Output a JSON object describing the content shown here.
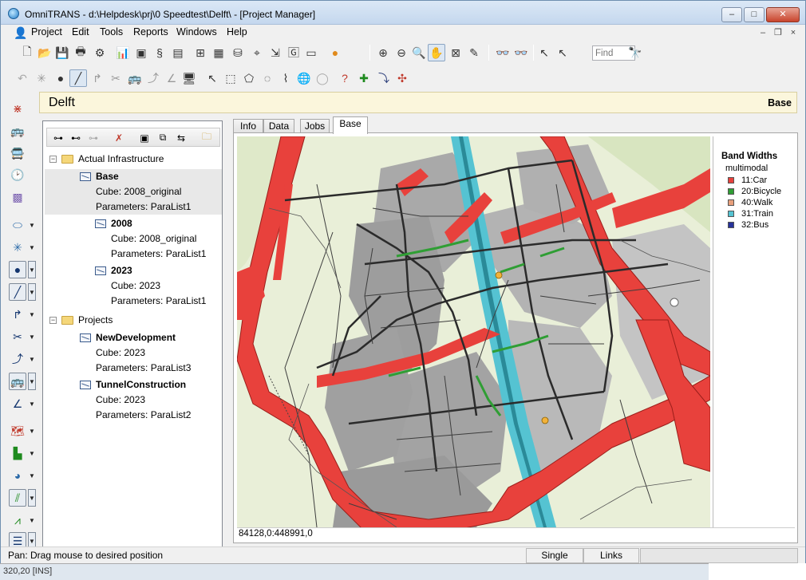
{
  "window": {
    "title": "OmniTRANS - d:\\Helpdesk\\prj\\0 Speedtest\\Delft\\ - [Project Manager]",
    "controls": {
      "minimize": "–",
      "maximize": "□",
      "close": "✕"
    }
  },
  "menubar": {
    "items": [
      "Project",
      "Edit",
      "Tools",
      "Reports",
      "Windows",
      "Help"
    ],
    "mdi_controls": {
      "minimize": "–",
      "restore": "❐",
      "close": "×"
    }
  },
  "toolbar": {
    "find_placeholder": "Find",
    "icons_row1": [
      "new-document",
      "open-folder",
      "save",
      "print",
      "settings-gear",
      "chart",
      "cube",
      "script",
      "report",
      "table",
      "matrix",
      "database",
      "network",
      "import",
      "globe",
      "toggle",
      "coin"
    ],
    "icons_row1_view": [
      "zoom-in",
      "zoom-out",
      "zoom-extent",
      "pan-hand",
      "zoom-window",
      "edit-pencil",
      "select-plus",
      "select-minus",
      "pointer-add",
      "pointer-remove"
    ],
    "icons_row2": [
      "undo",
      "star-node",
      "node",
      "link",
      "turn",
      "cut",
      "vehicle",
      "path",
      "angle",
      "screen",
      "pointer",
      "select-box",
      "select-poly",
      "select-circle",
      "select-free",
      "globe",
      "circle",
      "question",
      "add-cross",
      "connect",
      "split"
    ]
  },
  "header": {
    "title": "Delft",
    "scenario": "Base"
  },
  "tree": {
    "nodes": [
      {
        "type": "folder",
        "label": "Actual Infrastructure",
        "expander": "−"
      },
      {
        "type": "scenario",
        "label": "Base",
        "cube": "Cube: 2008_original",
        "params": "Parameters: ParaList1"
      },
      {
        "type": "scenario",
        "label": "2008",
        "cube": "Cube: 2008_original",
        "params": "Parameters: ParaList1"
      },
      {
        "type": "scenario",
        "label": "2023",
        "cube": "Cube: 2023",
        "params": "Parameters: ParaList1"
      },
      {
        "type": "folder",
        "label": "Projects",
        "expander": "−"
      },
      {
        "type": "scenario",
        "label": "NewDevelopment",
        "cube": "Cube: 2023",
        "params": "Parameters: ParaList3"
      },
      {
        "type": "scenario",
        "label": "TunnelConstruction",
        "cube": "Cube: 2023",
        "params": "Parameters: ParaList2"
      }
    ]
  },
  "tabs": [
    "Info",
    "Data",
    "Jobs",
    "Base"
  ],
  "active_tab": "Base",
  "legend": {
    "title": "Band Widths",
    "subtitle": "multimodal",
    "items": [
      {
        "label": "11:Car",
        "color": "#e8413c"
      },
      {
        "label": "20:Bicycle",
        "color": "#2f9e34"
      },
      {
        "label": "40:Walk",
        "color": "#e8a07c"
      },
      {
        "label": "31:Train",
        "color": "#55c3d2"
      },
      {
        "label": "32:Bus",
        "color": "#27339a"
      }
    ]
  },
  "coords": "84128,0:448991,0",
  "status": {
    "message": "Pan: Drag mouse to desired position",
    "mode": "Single",
    "layer": "Links"
  },
  "below_window": "320,20 [INS]",
  "colors": {
    "car": "#e8413c",
    "train_corridor": "#55c3d2",
    "map_background": "#e9efd8",
    "blocks": "#a9a9a9",
    "header_bg": "#fbf6dc"
  }
}
